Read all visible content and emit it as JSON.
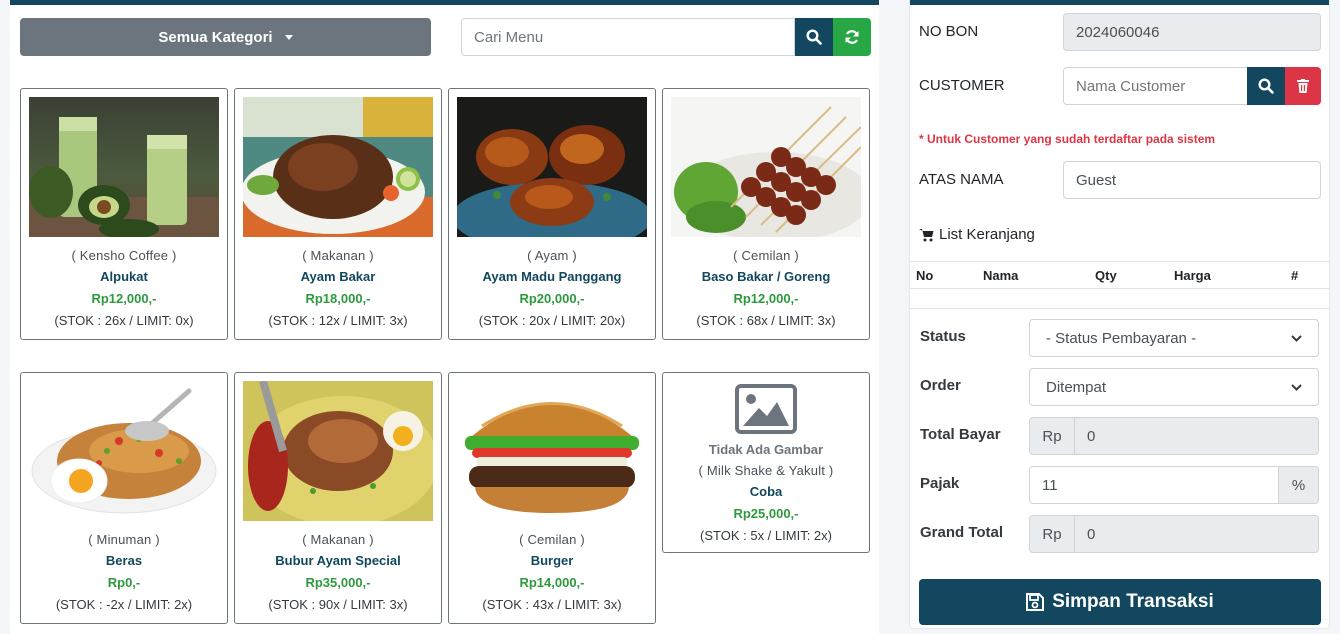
{
  "toolbar": {
    "category_label": "Semua Kategori",
    "search_placeholder": "Cari Menu"
  },
  "products": [
    {
      "category": "( Kensho Coffee )",
      "name": "Alpukat",
      "price": "Rp12,000,-",
      "stock": "(STOK : 26x / LIMIT: 0x)"
    },
    {
      "category": "( Makanan )",
      "name": "Ayam Bakar",
      "price": "Rp18,000,-",
      "stock": "(STOK : 12x / LIMIT: 3x)"
    },
    {
      "category": "( Ayam )",
      "name": "Ayam Madu Panggang",
      "price": "Rp20,000,-",
      "stock": "(STOK : 20x / LIMIT: 20x)"
    },
    {
      "category": "( Cemilan )",
      "name": "Baso Bakar / Goreng",
      "price": "Rp12,000,-",
      "stock": "(STOK : 68x / LIMIT: 3x)"
    },
    {
      "category": "( Minuman )",
      "name": "Beras",
      "price": "Rp0,-",
      "stock": "(STOK : -2x / LIMIT: 2x)"
    },
    {
      "category": "( Makanan )",
      "name": "Bubur Ayam Special",
      "price": "Rp35,000,-",
      "stock": "(STOK : 90x / LIMIT: 3x)"
    },
    {
      "category": "( Cemilan )",
      "name": "Burger",
      "price": "Rp14,000,-",
      "stock": "(STOK : 43x / LIMIT: 3x)"
    },
    {
      "no_image_text": "Tidak Ada Gambar",
      "category": "( Milk Shake & Yakult )",
      "name": "Coba",
      "price": "Rp25,000,-",
      "stock": "(STOK : 5x / LIMIT: 2x)"
    }
  ],
  "form": {
    "no_bon_label": "NO BON",
    "no_bon_value": "2024060046",
    "customer_label": "CUSTOMER",
    "customer_placeholder": "Nama Customer",
    "customer_note": "* Untuk Customer yang sudah terdaftar pada sistem",
    "atas_nama_label": "ATAS NAMA",
    "atas_nama_value": "Guest"
  },
  "cart": {
    "title": "List Keranjang",
    "columns": [
      "No",
      "Nama",
      "Qty",
      "Harga",
      "#"
    ]
  },
  "payment": {
    "status_label": "Status",
    "status_value": "- Status Pembayaran -",
    "order_label": "Order",
    "order_value": "Ditempat",
    "total_label": "Total Bayar",
    "total_prefix": "Rp",
    "total_value": "0",
    "tax_label": "Pajak",
    "tax_value": "11",
    "tax_suffix": "%",
    "grand_label": "Grand Total",
    "grand_prefix": "Rp",
    "grand_value": "0",
    "save_label": "Simpan Transaksi"
  },
  "colors": {
    "primary": "#12475f",
    "success": "#28a745",
    "danger": "#dc3545",
    "secondary": "#6c757d"
  }
}
